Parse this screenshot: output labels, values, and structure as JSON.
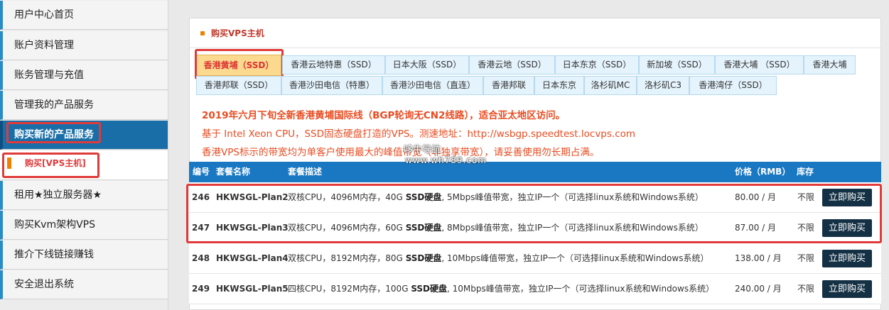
{
  "sidebar": {
    "items": [
      {
        "label": "用户中心首页"
      },
      {
        "label": "账户资料管理"
      },
      {
        "label": "账务管理与充值"
      },
      {
        "label": "管理我的产品服务"
      },
      {
        "label": "购买新的产品服务"
      },
      {
        "label": "租用★独立服务器★"
      },
      {
        "label": "购买Kvm架构VPS"
      },
      {
        "label": "推介下线链接赚钱"
      },
      {
        "label": "安全退出系统"
      }
    ],
    "sub_item": "购买[VPS主机]"
  },
  "panel": {
    "title": "购买VPS主机"
  },
  "tabs": [
    {
      "label": "香港黄埔（SSD）",
      "selected": true
    },
    {
      "label": "香港云地特惠（SSD）"
    },
    {
      "label": "日本大阪（SSD）"
    },
    {
      "label": "香港云地（SSD）"
    },
    {
      "label": "日本东京（SSD）"
    },
    {
      "label": "新加坡（SSD）"
    },
    {
      "label": "香港大埔 （SSD）"
    },
    {
      "label": "香港大埔"
    },
    {
      "label": "香港邦联（SSD）"
    },
    {
      "label": "香港沙田电信（特惠）"
    },
    {
      "label": "香港沙田电信（直连）"
    },
    {
      "label": "香港邦联"
    },
    {
      "label": "日本东京"
    },
    {
      "label": "洛杉矶MC"
    },
    {
      "label": "洛杉矶C3"
    },
    {
      "label": "香港湾仔（SSD）"
    }
  ],
  "notices": {
    "line1": "2019年六月下旬全新香港黄埔国际线（BGP轮询无CN2线路），适合亚太地区访问。",
    "line2": "基于 Intel Xeon CPU，SSD固态硬盘打造的VPS。测速地址：http://wsbgp.speedtest.locvps.com",
    "line3": "香港VPS标示的带宽均为单客户使用最大的峰值带宽（非独享带宽），请妥善使用勿长期占满。"
  },
  "watermark": {
    "line1": "哆牛导航",
    "line2": "www.wh789.com"
  },
  "table": {
    "headers": {
      "id": "编号",
      "name": "套餐名称",
      "desc": "套餐描述",
      "price": "价格（RMB）",
      "stock": "库存"
    },
    "buy_label": "立即购买",
    "rows": [
      {
        "id": "246",
        "name": "HKWSGL-Plan2",
        "desc_pre": "双核CPU，4096M内存，40G ",
        "desc_ssd": "SSD硬盘",
        "desc_post": ", 5Mbps峰值带宽，独立IP一个（可选择linux系统和Windows系统）",
        "price": "80.00 / 月",
        "stock": "不限"
      },
      {
        "id": "247",
        "name": "HKWSGL-Plan3",
        "desc_pre": "双核CPU，4096M内存，60G ",
        "desc_ssd": "SSD硬盘",
        "desc_post": ", 8Mbps峰值带宽，独立IP一个（可选择linux系统和Windows系统）",
        "price": "87.00 / 月",
        "stock": "不限"
      },
      {
        "id": "248",
        "name": "HKWSGL-Plan4",
        "desc_pre": "双核CPU，8192M内存，80G ",
        "desc_ssd": "SSD硬盘",
        "desc_post": ", 10Mbps峰值带宽，独立IP一个（可选择linux系统和Windows系统）",
        "price": "138.00 / 月",
        "stock": "不限"
      },
      {
        "id": "249",
        "name": "HKWSGL-Plan5",
        "desc_pre": "四核CPU，8192M内存，100G ",
        "desc_ssd": "SSD硬盘",
        "desc_post": ", 10Mbps峰值带宽，独立IP一个（可选择linux系统和Windows系统）",
        "price": "240.00 / 月",
        "stock": "不限"
      }
    ]
  },
  "colors": {
    "accent": "#1a78c2",
    "highlight": "#e03a3a",
    "notice": "#e84c22",
    "button": "#143044"
  }
}
